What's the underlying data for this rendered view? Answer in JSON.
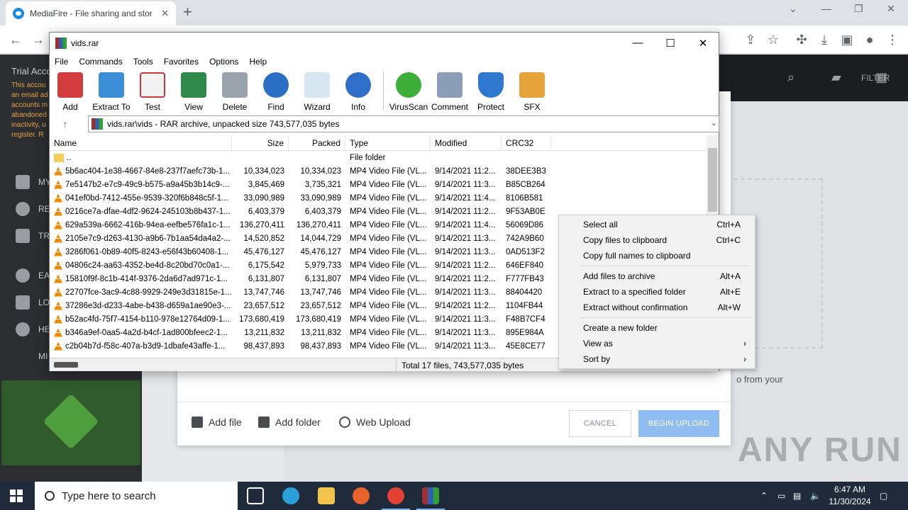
{
  "browser": {
    "tab_title": "MediaFire - File sharing and stor",
    "tab_close": "✕",
    "new_tab": "+",
    "win_min": "⌄",
    "win_min2": "—",
    "win_max": "❐",
    "win_close": "✕"
  },
  "mediafire": {
    "trial_title": "Trial Acco",
    "trial_text": "This accou an email ad accounts m abandoned inactivity, u register. R",
    "nav": [
      {
        "label": "MY",
        "icon": "folder-icon"
      },
      {
        "label": "RE",
        "icon": "clock-icon"
      },
      {
        "label": "TR",
        "icon": "trash-icon"
      },
      {
        "label": "EA",
        "icon": "plus-circle-icon"
      },
      {
        "label": "LO",
        "icon": "logout-icon"
      },
      {
        "label": "HE",
        "icon": "help-icon"
      },
      {
        "label": "MI",
        "icon": "more-icon"
      }
    ],
    "filter_label": "FILTER",
    "add_file": "Add file",
    "add_folder": "Add folder",
    "web_upload": "Web Upload",
    "cancel": "CANCEL",
    "begin_upload": "BEGIN UPLOAD",
    "from_your": "o from your"
  },
  "rar": {
    "title": "vids.rar",
    "menu": [
      "File",
      "Commands",
      "Tools",
      "Favorites",
      "Options",
      "Help"
    ],
    "tools": [
      {
        "label": "Add",
        "color": "#d23c3c"
      },
      {
        "label": "Extract To",
        "color": "#3a8fd8"
      },
      {
        "label": "Test",
        "color": "#c83a3a"
      },
      {
        "label": "View",
        "color": "#2f8a4a"
      },
      {
        "label": "Delete",
        "color": "#7c8591"
      },
      {
        "label": "Find",
        "color": "#2b6fc4"
      },
      {
        "label": "Wizard",
        "color": "#8fb7d9"
      },
      {
        "label": "Info",
        "color": "#2f6fc9"
      }
    ],
    "tools2": [
      {
        "label": "VirusScan",
        "color": "#3cae3a"
      },
      {
        "label": "Comment",
        "color": "#8c9db8"
      },
      {
        "label": "Protect",
        "color": "#2f78d0"
      },
      {
        "label": "SFX",
        "color": "#e6a33a"
      }
    ],
    "address": "vids.rar\\vids - RAR archive, unpacked size 743,577,035 bytes",
    "columns": {
      "name": "Name",
      "size": "Size",
      "packed": "Packed",
      "type": "Type",
      "modified": "Modified",
      "crc": "CRC32"
    },
    "parent": {
      "name": "..",
      "type": "File folder"
    },
    "rows": [
      {
        "name": "5b6ac404-1e38-4667-84e8-237f7aefc73b-1...",
        "size": "10,334,023",
        "packed": "10,334,023",
        "type": "MP4 Video File (VL...",
        "modified": "9/14/2021 11:2...",
        "crc": "38DEE3B3"
      },
      {
        "name": "7e5147b2-e7c9-49c9-b575-a9a45b3b14c9-...",
        "size": "3,845,469",
        "packed": "3,735,321",
        "type": "MP4 Video File (VL...",
        "modified": "9/14/2021 11:3...",
        "crc": "B85CB264"
      },
      {
        "name": "041ef0bd-7412-455e-9539-320f6b848c5f-1...",
        "size": "33,090,989",
        "packed": "33,090,989",
        "type": "MP4 Video File (VL...",
        "modified": "9/14/2021 11:4...",
        "crc": "8106B581"
      },
      {
        "name": "0216ce7a-dfae-4df2-9624-245103b8b437-1...",
        "size": "6,403,379",
        "packed": "6,403,379",
        "type": "MP4 Video File (VL...",
        "modified": "9/14/2021 11:2...",
        "crc": "9F53AB0E"
      },
      {
        "name": "629a539a-6662-416b-94ea-eefbe576fa1c-1...",
        "size": "136,270,411",
        "packed": "136,270,411",
        "type": "MP4 Video File (VL...",
        "modified": "9/14/2021 11:4...",
        "crc": "56069D86"
      },
      {
        "name": "2105e7c9-d263-4130-a9b6-7b1aa54da4a2-...",
        "size": "14,520,852",
        "packed": "14,044,729",
        "type": "MP4 Video File (VL...",
        "modified": "9/14/2021 11:3...",
        "crc": "742A9B60"
      },
      {
        "name": "3286f061-0b89-40f5-8243-e56f43b60408-1...",
        "size": "45,476,127",
        "packed": "45,476,127",
        "type": "MP4 Video File (VL...",
        "modified": "9/14/2021 11:3...",
        "crc": "0AD513F2"
      },
      {
        "name": "04806c24-aa63-4352-be4d-8c20bd70c0a1-...",
        "size": "6,175,542",
        "packed": "5,979,733",
        "type": "MP4 Video File (VL...",
        "modified": "9/14/2021 11:2...",
        "crc": "646EF840"
      },
      {
        "name": "15810f9f-8c1b-414f-9376-2da6d7ad971c-1...",
        "size": "6,131,807",
        "packed": "6,131,807",
        "type": "MP4 Video File (VL...",
        "modified": "9/14/2021 11:2...",
        "crc": "F777FB43"
      },
      {
        "name": "22707fce-3ac9-4c88-9929-249e3d31815e-1...",
        "size": "13,747,746",
        "packed": "13,747,746",
        "type": "MP4 Video File (VL...",
        "modified": "9/14/2021 11:3...",
        "crc": "88404420"
      },
      {
        "name": "37286e3d-d233-4abe-b438-d659a1ae90e3-...",
        "size": "23,657,512",
        "packed": "23,657,512",
        "type": "MP4 Video File (VL...",
        "modified": "9/14/2021 11:2...",
        "crc": "1104FB44"
      },
      {
        "name": "b52ac4fd-75f7-4154-b110-978e12764d09-1...",
        "size": "173,680,419",
        "packed": "173,680,419",
        "type": "MP4 Video File (VL...",
        "modified": "9/14/2021 11:3...",
        "crc": "F48B7CF4"
      },
      {
        "name": "b346a9ef-0aa5-4a2d-b4cf-1ad800bfeec2-1...",
        "size": "13,211,832",
        "packed": "13,211,832",
        "type": "MP4 Video File (VL...",
        "modified": "9/14/2021 11:3...",
        "crc": "895E984A"
      },
      {
        "name": "c2b04b7d-f58c-407a-b3d9-1dbafe43affe-1...",
        "size": "98,437,893",
        "packed": "98,437,893",
        "type": "MP4 Video File (VL...",
        "modified": "9/14/2021 11:3...",
        "crc": "45E8CE77"
      }
    ],
    "status": "Total 17 files, 743,577,035 bytes"
  },
  "context_menu": {
    "items": [
      {
        "label": "Select all",
        "shortcut": "Ctrl+A"
      },
      {
        "label": "Copy files to clipboard",
        "shortcut": "Ctrl+C"
      },
      {
        "label": "Copy full names to clipboard",
        "shortcut": ""
      },
      {
        "label": "Add files to archive",
        "shortcut": "Alt+A"
      },
      {
        "label": "Extract to a specified folder",
        "shortcut": "Alt+E"
      },
      {
        "label": "Extract without confirmation",
        "shortcut": "Alt+W"
      },
      {
        "label": "Create a new folder",
        "shortcut": ""
      },
      {
        "label": "View as",
        "shortcut": ""
      },
      {
        "label": "Sort by",
        "shortcut": ""
      }
    ]
  },
  "taskbar": {
    "search_placeholder": "Type here to search",
    "time": "6:47 AM",
    "date": "11/30/2024"
  },
  "watermark": "ANY RUN"
}
